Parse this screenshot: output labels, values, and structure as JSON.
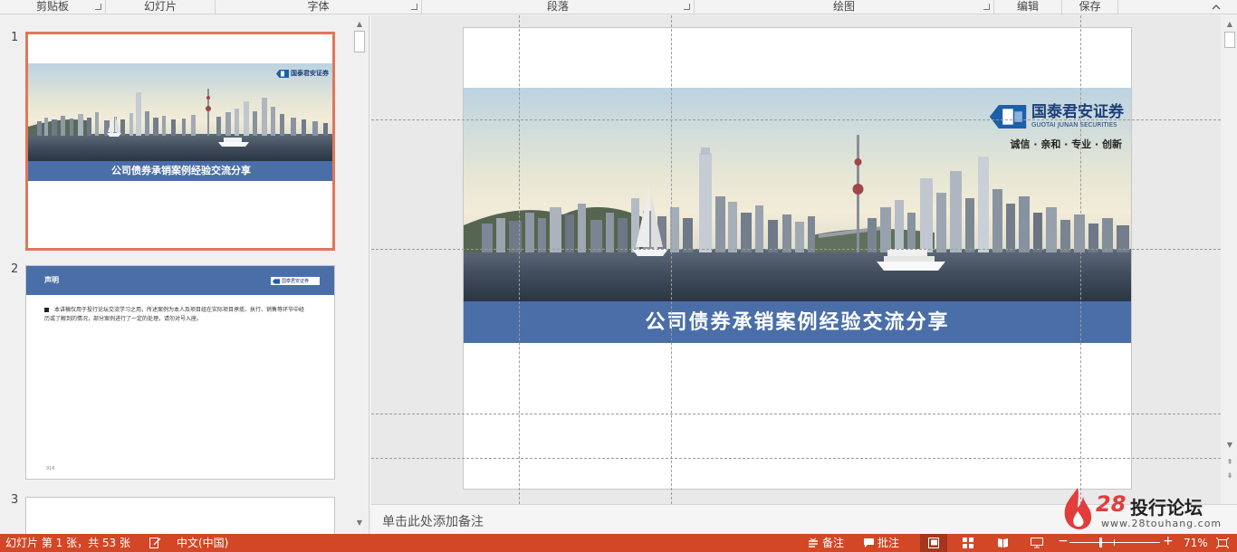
{
  "ribbon": {
    "groups": [
      {
        "label": "剪贴板",
        "launcher": true
      },
      {
        "label": "幻灯片",
        "launcher": false
      },
      {
        "label": "字体",
        "launcher": true
      },
      {
        "label": "段落",
        "launcher": true
      },
      {
        "label": "绘图",
        "launcher": true
      },
      {
        "label": "编辑",
        "launcher": false
      },
      {
        "label": "保存",
        "launcher": false
      }
    ]
  },
  "thumbnails": {
    "items": [
      {
        "number": "1",
        "title": "公司债券承销案例经验交流分享",
        "selected": true
      },
      {
        "number": "2",
        "title": "声明",
        "body": "本讲稿仅用于投行论坛交流学习之用，所述案例为本人及项目组在实际项目承揽、执行、销售等环节中经历或了解到的情况，部分案例进行了一定的处理，请勿对号入座。",
        "footer": "916"
      },
      {
        "number": "3"
      }
    ]
  },
  "slide": {
    "logo_cn": "国泰君安证券",
    "logo_en": "GUOTAI JUNAN SECURITIES",
    "slogan": "诚信 · 亲和 · 专业 · 创新",
    "title": "公司债券承销案例经验交流分享"
  },
  "notes": {
    "placeholder": "单击此处添加备注"
  },
  "watermark": {
    "number": "28",
    "text": "投行论坛",
    "url": "www.28touhang.com"
  },
  "status": {
    "slide_info": "幻灯片 第 1 张，共 53 张",
    "language": "中文(中国)",
    "notes_label": "备注",
    "comments_label": "批注",
    "zoom": "71%",
    "zoom_value": 0.71
  },
  "colors": {
    "status_bar": "#d24726",
    "selected_thumb_border": "#e0775a",
    "banner": "#4a6ea8"
  }
}
